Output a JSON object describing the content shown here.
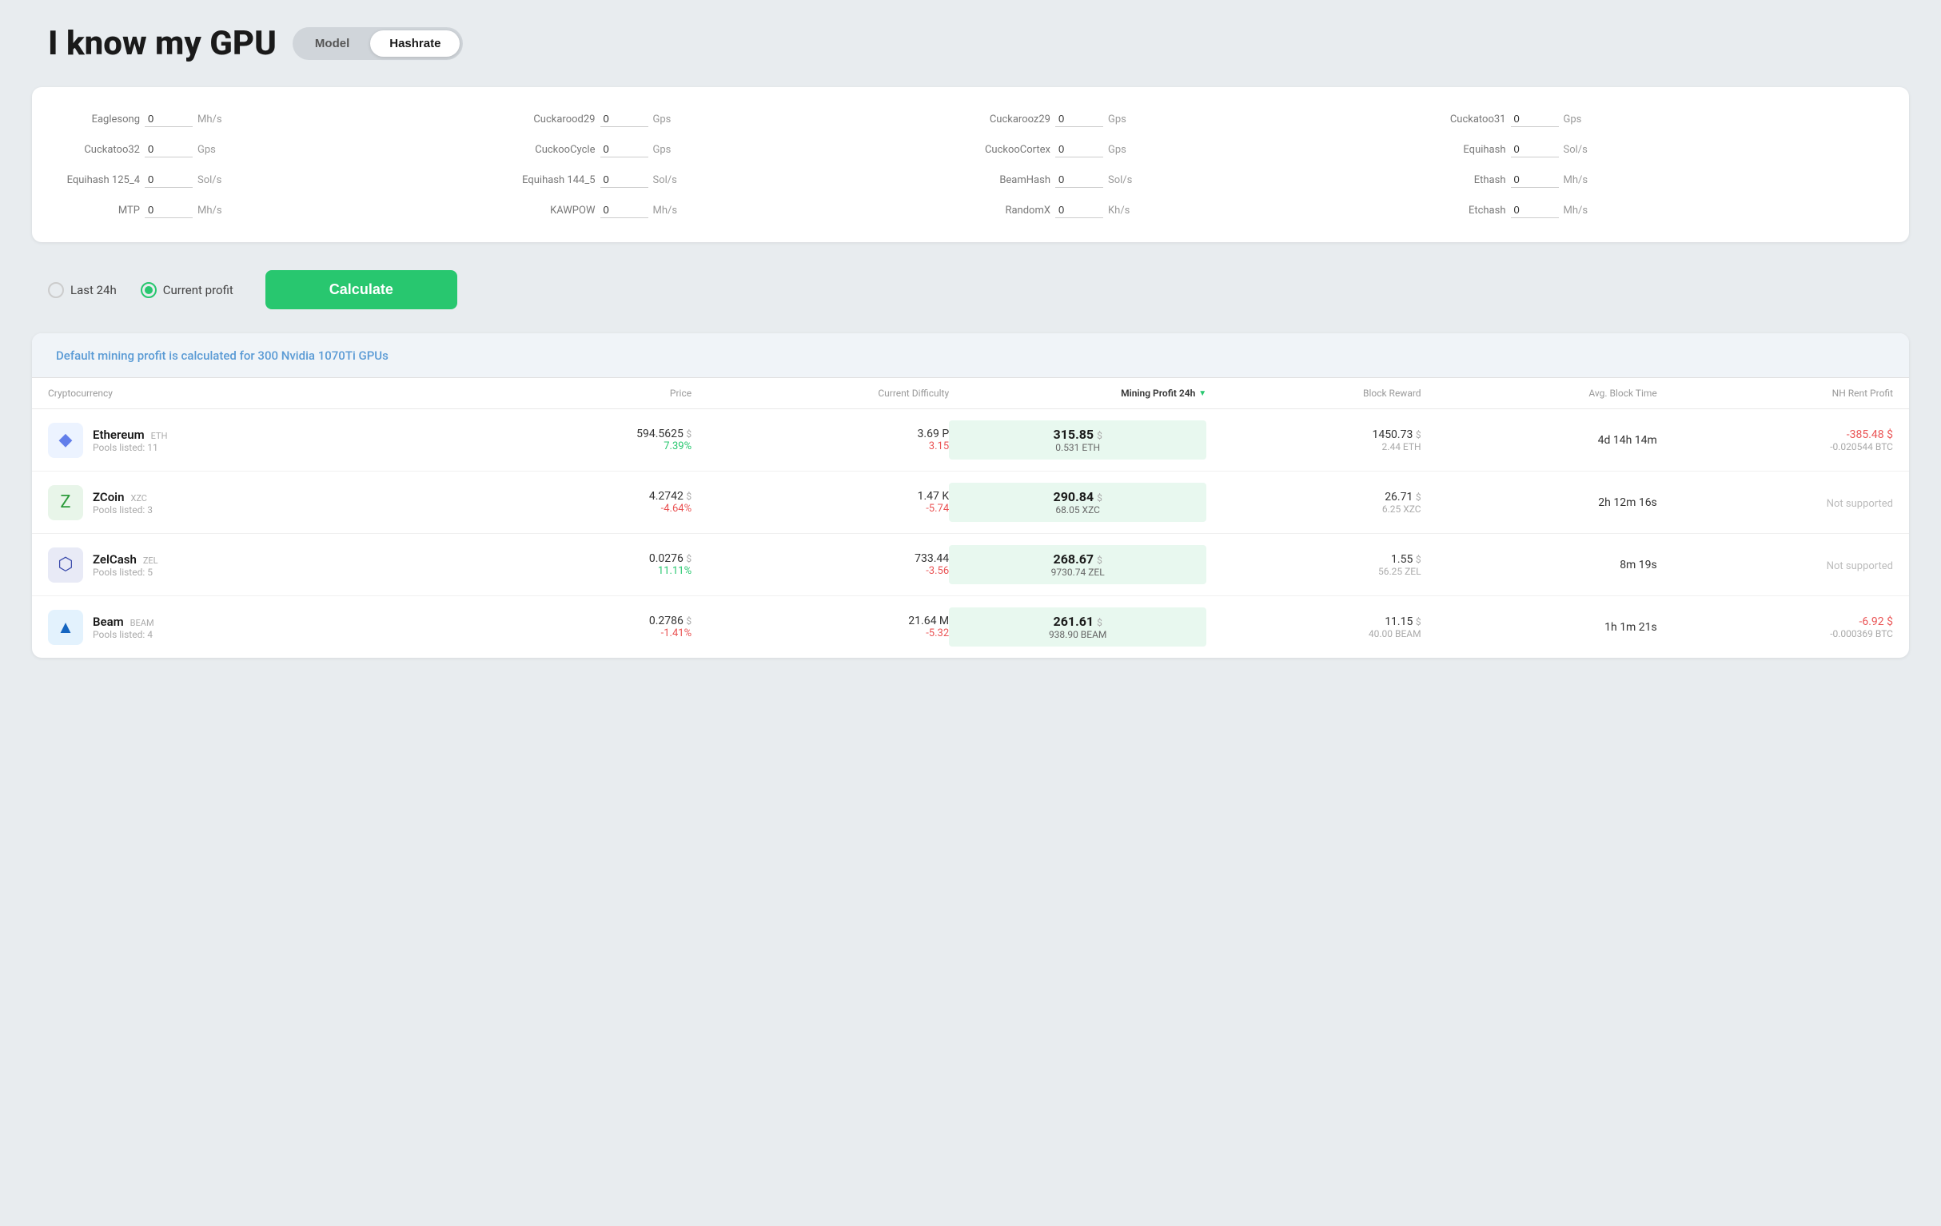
{
  "header": {
    "title": "I know my GPU",
    "toggle": {
      "model_label": "Model",
      "hashrate_label": "Hashrate",
      "active": "Hashrate"
    }
  },
  "hashrate_fields": [
    {
      "label": "Eaglesong",
      "value": "0",
      "unit": "Mh/s"
    },
    {
      "label": "Cuckarood29",
      "value": "0",
      "unit": "Gps"
    },
    {
      "label": "Cuckarooz29",
      "value": "0",
      "unit": "Gps"
    },
    {
      "label": "Cuckatoo31",
      "value": "0",
      "unit": "Gps"
    },
    {
      "label": "Cuckatoo32",
      "value": "0",
      "unit": "Gps"
    },
    {
      "label": "CuckooCycle",
      "value": "0",
      "unit": "Gps"
    },
    {
      "label": "CuckooCortex",
      "value": "0",
      "unit": "Gps"
    },
    {
      "label": "Equihash",
      "value": "0",
      "unit": "Sol/s"
    },
    {
      "label": "Equihash 125_4",
      "value": "0",
      "unit": "Sol/s"
    },
    {
      "label": "Equihash 144_5",
      "value": "0",
      "unit": "Sol/s"
    },
    {
      "label": "BeamHash",
      "value": "0",
      "unit": "Sol/s"
    },
    {
      "label": "Ethash",
      "value": "0",
      "unit": "Mh/s"
    },
    {
      "label": "MTP",
      "value": "0",
      "unit": "Mh/s"
    },
    {
      "label": "KAWPOW",
      "value": "0",
      "unit": "Mh/s"
    },
    {
      "label": "RandomX",
      "value": "0",
      "unit": "Kh/s"
    },
    {
      "label": "Etchash",
      "value": "0",
      "unit": "Mh/s"
    }
  ],
  "controls": {
    "last24h_label": "Last 24h",
    "current_profit_label": "Current profit",
    "selected": "current_profit",
    "calculate_label": "Calculate"
  },
  "results": {
    "info_text": "Default mining profit is calculated for 300 Nvidia 1070Ti GPUs",
    "table_headers": {
      "cryptocurrency": "Cryptocurrency",
      "price": "Price",
      "current_difficulty": "Current Difficulty",
      "mining_profit_24h": "Mining Profit 24h",
      "block_reward": "Block Reward",
      "avg_block_time": "Avg. Block Time",
      "nh_rent_profit": "NH Rent Profit"
    },
    "rows": [
      {
        "name": "Ethereum",
        "ticker": "ETH",
        "pools": "11",
        "icon": "eth",
        "price": "594.5625",
        "price_change": "7.39%",
        "price_change_positive": true,
        "difficulty": "3.69 P",
        "difficulty_change": "3.15",
        "difficulty_change_positive": false,
        "profit_main": "315.85",
        "profit_sub": "0.531 ETH",
        "block_reward_usd": "1450.73",
        "block_reward_crypto": "2.44 ETH",
        "avg_block_time": "4d 14h 14m",
        "nh_profit": "-385.48",
        "nh_profit_btc": "-0.020544 BTC",
        "nh_supported": true
      },
      {
        "name": "ZCoin",
        "ticker": "XZC",
        "pools": "3",
        "icon": "zcoin",
        "price": "4.2742",
        "price_change": "-4.64%",
        "price_change_positive": false,
        "difficulty": "1.47 K",
        "difficulty_change": "-5.74",
        "difficulty_change_positive": false,
        "profit_main": "290.84",
        "profit_sub": "68.05 XZC",
        "block_reward_usd": "26.71",
        "block_reward_crypto": "6.25 XZC",
        "avg_block_time": "2h 12m 16s",
        "nh_profit": "",
        "nh_profit_btc": "",
        "nh_supported": false
      },
      {
        "name": "ZelCash",
        "ticker": "ZEL",
        "pools": "5",
        "icon": "zelcash",
        "price": "0.0276",
        "price_change": "11.11%",
        "price_change_positive": true,
        "difficulty": "733.44",
        "difficulty_change": "-3.56",
        "difficulty_change_positive": false,
        "profit_main": "268.67",
        "profit_sub": "9730.74 ZEL",
        "block_reward_usd": "1.55",
        "block_reward_crypto": "56.25 ZEL",
        "avg_block_time": "8m 19s",
        "nh_profit": "",
        "nh_profit_btc": "",
        "nh_supported": false
      },
      {
        "name": "Beam",
        "ticker": "BEAM",
        "pools": "4",
        "icon": "beam",
        "price": "0.2786",
        "price_change": "-1.41%",
        "price_change_positive": false,
        "difficulty": "21.64 M",
        "difficulty_change": "-5.32",
        "difficulty_change_positive": false,
        "profit_main": "261.61",
        "profit_sub": "938.90 BEAM",
        "block_reward_usd": "11.15",
        "block_reward_crypto": "40.00 BEAM",
        "avg_block_time": "1h 1m 21s",
        "nh_profit": "-6.92",
        "nh_profit_btc": "-0.000369 BTC",
        "nh_supported": true
      }
    ]
  }
}
